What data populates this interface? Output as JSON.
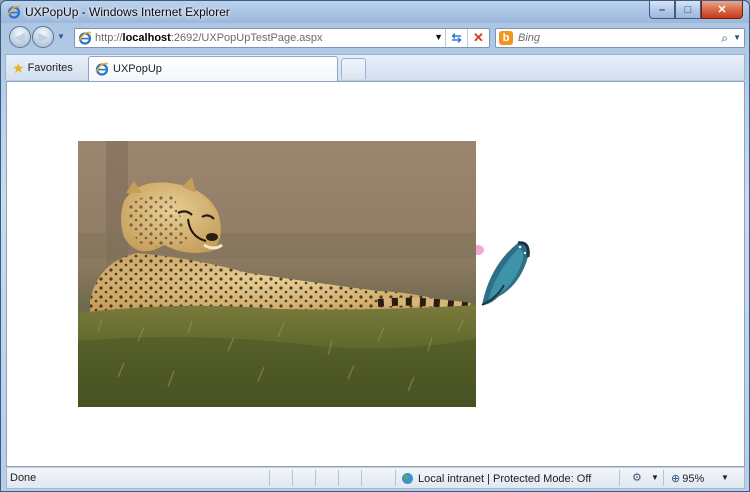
{
  "window": {
    "title": "UXPopUp - Windows Internet Explorer",
    "minimize_glyph": "–",
    "maximize_glyph": "□",
    "close_glyph": "✕"
  },
  "nav": {
    "back_glyph": "◀",
    "forward_glyph": "▶",
    "dropdown_glyph": "▼"
  },
  "address": {
    "prefix": "http://",
    "host": "localhost",
    "path": ":2692/UXPopUpTestPage.aspx",
    "dropdown_glyph": "▼",
    "refresh_glyph": "⇆",
    "stop_glyph": "✕"
  },
  "search": {
    "engine_glyph": "b",
    "placeholder": "Bing",
    "go_glyph": "⌕",
    "dropdown_glyph": "▼"
  },
  "favorites": {
    "star_glyph": "★",
    "label": "Favorites"
  },
  "tabs": [
    {
      "label": "UXPopUp"
    }
  ],
  "content": {
    "images": [
      {
        "name": "cheetah-image",
        "subject": "cheetah lying on grass"
      },
      {
        "name": "butterfly-image",
        "subject": "blue morpho butterfly on pink flower"
      }
    ]
  },
  "status": {
    "text": "Done",
    "zone": "Local intranet | Protected Mode: Off",
    "tools_glyph": "⚙",
    "zoom_glyph": "⊕",
    "zoom": "95%",
    "dropdown_glyph": "▼"
  },
  "colors": {
    "frame": "#a8c3e2",
    "close_button": "#c4391c",
    "refresh": "#2f7bd8",
    "stop": "#d93a1f",
    "bing": "#f0951f",
    "favorites_star": "#e8b41a"
  }
}
